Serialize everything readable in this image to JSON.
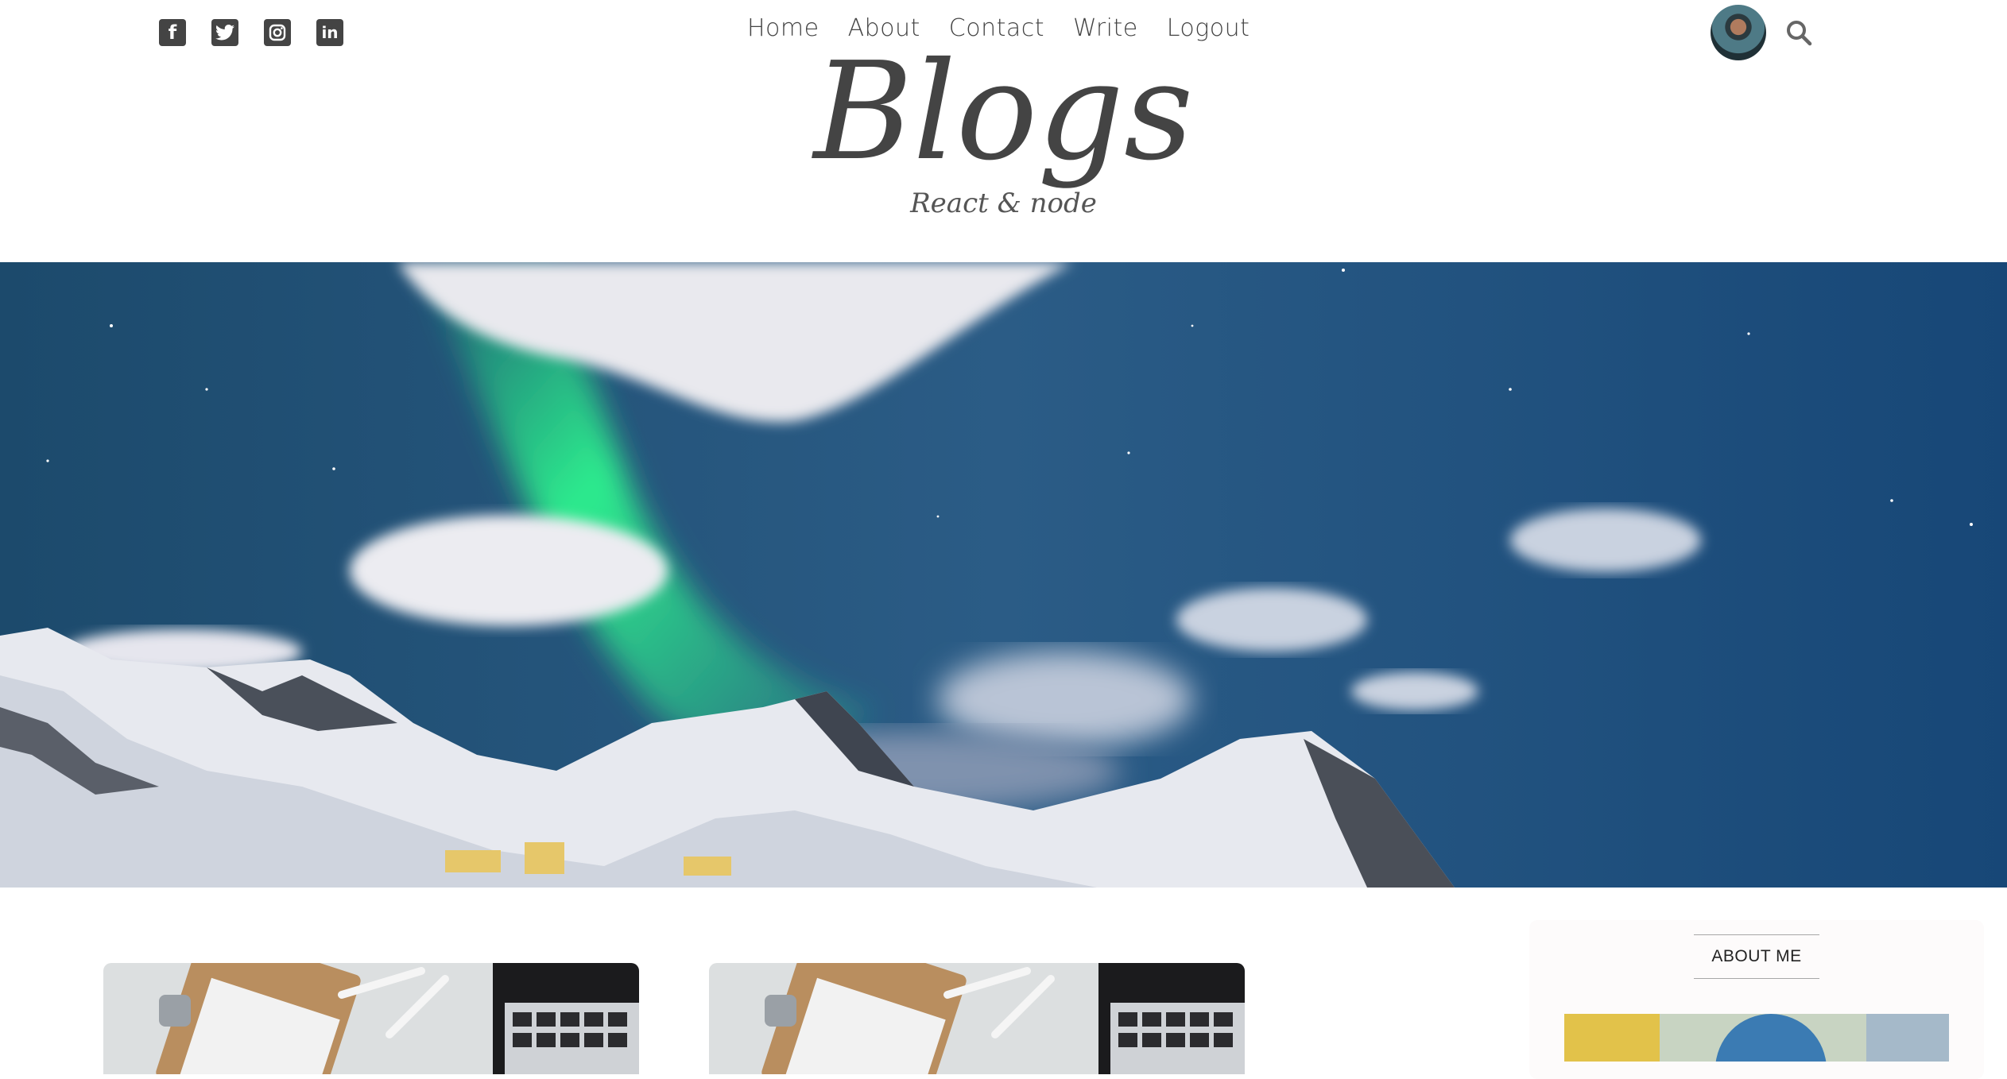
{
  "header": {
    "social_icons": [
      {
        "name": "facebook-icon",
        "glyph": "f"
      },
      {
        "name": "twitter-icon",
        "glyph": ""
      },
      {
        "name": "instagram-icon",
        "glyph": ""
      },
      {
        "name": "linkedin-icon",
        "glyph": "in"
      }
    ],
    "nav": {
      "home": "Home",
      "about": "About",
      "contact": "Contact",
      "write": "Write",
      "logout": "Logout"
    },
    "search_icon": "search-icon"
  },
  "site": {
    "title": "Blogs",
    "subtitle": "React & node"
  },
  "sidebar": {
    "title": "ABOUT ME"
  },
  "colors": {
    "text": "#444444",
    "sidebar_bg": "#fdfbfb",
    "aurora_green": "#2ef58f",
    "sky": "#1f4f7a"
  }
}
